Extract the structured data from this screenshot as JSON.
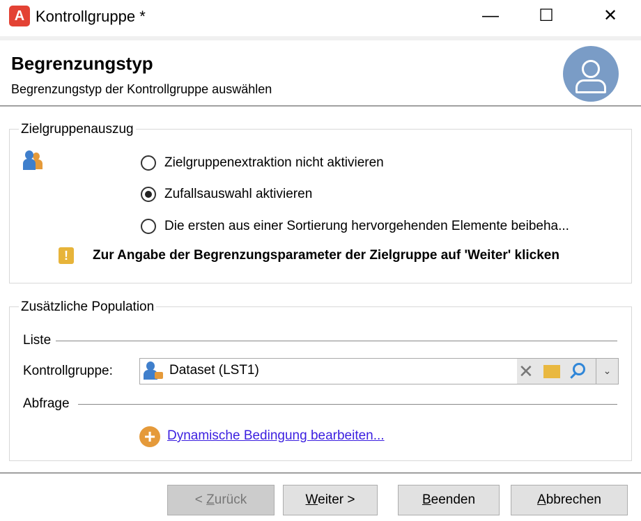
{
  "window": {
    "title": "Kontrollgruppe *",
    "app_icon": "A",
    "minimize": "—",
    "maximize": "☐",
    "close": "✕"
  },
  "header": {
    "title": "Begrenzungstyp",
    "subtitle": "Begrenzungstyp der Kontrollgruppe auswählen"
  },
  "group1": {
    "legend": "Zielgruppenauszug",
    "options": [
      {
        "label": "Zielgruppenextraktion nicht aktivieren",
        "selected": false
      },
      {
        "label": "Zufallsauswahl aktivieren",
        "selected": true
      },
      {
        "label": "Die ersten aus einer Sortierung hervorgehenden Elemente beibeha..."
      }
    ],
    "warning_icon": "!",
    "warning": "Zur Angabe der Begrenzungsparameter der Zielgruppe auf 'Weiter' klicken"
  },
  "group2": {
    "legend": "Zusätzliche Population",
    "list_label": "Liste",
    "control_label": "Kontrollgruppe:",
    "control_value": "Dataset (LST1)",
    "query_label": "Abfrage",
    "link": "Dynamische Bedingung bearbeiten..."
  },
  "buttons": {
    "back": {
      "pre": "< ",
      "key": "Z",
      "rest": "urück"
    },
    "next": {
      "key": "W",
      "rest": "eiter >"
    },
    "finish": {
      "key": "B",
      "rest": "eenden"
    },
    "cancel": {
      "key": "A",
      "rest": "bbrechen"
    }
  },
  "colors": {
    "accent": "#e34234",
    "link": "#3b1fe0",
    "warning": "#e7b43a"
  }
}
